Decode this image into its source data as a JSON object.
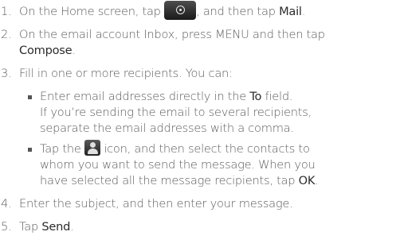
{
  "steps": [
    {
      "num": "1.",
      "a": "On the Home screen, tap",
      "b": ", and then tap",
      "mail": "Mail",
      "end": "."
    },
    {
      "num": "2.",
      "line1": "On the email account Inbox, press MENU and then tap",
      "compose": "Compose",
      "end": "."
    },
    {
      "num": "3.",
      "line1": "Fill in one or more recipients. You can:",
      "bullet1": {
        "line1_a": "Enter email addresses directly in the",
        "to": "To",
        "line1_b": "field.",
        "line2": "If you’re sending the email to several recipients,",
        "line3": "separate the email addresses with a comma."
      },
      "bullet2": {
        "line1_a": "Tap the",
        "line1_b": "icon, and then select the contacts to",
        "line2": "whom you want to send the message. When you",
        "line3_a": "have selected all the message recipients, tap",
        "ok": "OK",
        "end": "."
      }
    },
    {
      "num": "4.",
      "line1": "Enter the subject, and then enter your message."
    },
    {
      "num": "5.",
      "a": "Tap",
      "send": "Send",
      "end": "."
    }
  ]
}
